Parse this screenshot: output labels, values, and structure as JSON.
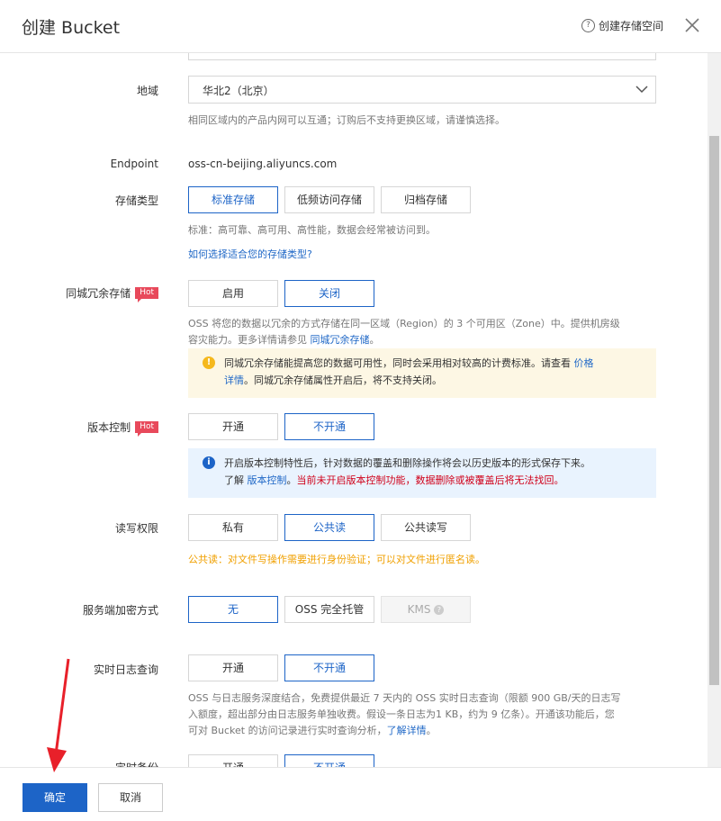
{
  "header": {
    "title": "创建 Bucket",
    "help_label": "创建存储空间"
  },
  "region": {
    "label": "地域",
    "value": "华北2（北京）",
    "desc": "相同区域内的产品内网可以互通；订购后不支持更换区域，请谨慎选择。"
  },
  "endpoint": {
    "label": "Endpoint",
    "value": "oss-cn-beijing.aliyuncs.com"
  },
  "storage_type": {
    "label": "存储类型",
    "options": [
      "标准存储",
      "低频访问存储",
      "归档存储"
    ],
    "selected": "标准存储",
    "desc": "标准：高可靠、高可用、高性能，数据会经常被访问到。",
    "link": "如何选择适合您的存储类型?"
  },
  "zone_redundancy": {
    "label": "同城冗余存储",
    "badge": "Hot",
    "options": [
      "启用",
      "关闭"
    ],
    "selected": "关闭",
    "desc_1": "OSS 将您的数据以冗余的方式存储在同一区域（Region）的 3 个可用区（Zone）中。提供机房级",
    "desc_2": "容灾能力。更多详情请参见 ",
    "desc_link": "同城冗余存储",
    "desc_end": "。",
    "warn_1": "同城冗余存储能提高您的数据可用性，同时会采用相对较高的计费标准。请查看 ",
    "warn_link_1": "价格",
    "warn_link_2": "详情",
    "warn_2": "。同城冗余存储属性开启后，将不支持关闭。"
  },
  "versioning": {
    "label": "版本控制",
    "badge": "Hot",
    "options": [
      "开通",
      "不开通"
    ],
    "selected": "不开通",
    "info_1": "开启版本控制特性后，针对数据的覆盖和删除操作将会以历史版本的形式保存下来。",
    "info_2_prefix": "了解 ",
    "info_2_link": "版本控制",
    "info_2_suffix": "。",
    "info_2_red": "当前未开启版本控制功能，数据删除或被覆盖后将无法找回。"
  },
  "acl": {
    "label": "读写权限",
    "options": [
      "私有",
      "公共读",
      "公共读写"
    ],
    "selected": "公共读",
    "note": "公共读：对文件写操作需要进行身份验证；可以对文件进行匿名读。"
  },
  "encryption": {
    "label": "服务端加密方式",
    "options": [
      "无",
      "OSS 完全托管",
      "KMS"
    ],
    "selected": "无",
    "kms_help": "?"
  },
  "realtime_log": {
    "label": "实时日志查询",
    "options": [
      "开通",
      "不开通"
    ],
    "selected": "不开通",
    "desc_1": "OSS 与日志服务深度结合，免费提供最近 7 天内的 OSS 实时日志查询（限额 900 GB/天的日志写",
    "desc_2": "入额度，超出部分由日志服务单独收费。假设一条日志为1 KB，约为 9 亿条）。开通该功能后，您",
    "desc_3": "可对 Bucket 的访问记录进行实时查询分析，",
    "desc_link": "了解详情",
    "desc_end": "。"
  },
  "backup": {
    "label": "定时备份",
    "options": [
      "开通",
      "不开通"
    ],
    "selected": "不开通"
  },
  "footer": {
    "ok": "确定",
    "cancel": "取消"
  },
  "colors": {
    "primary": "#1d64c7",
    "hot": "#e8495b",
    "warning_bg": "#fdf7e4",
    "info_bg": "#e9f3fe",
    "note_orange": "#f0a000",
    "arrow": "#e8202a"
  }
}
